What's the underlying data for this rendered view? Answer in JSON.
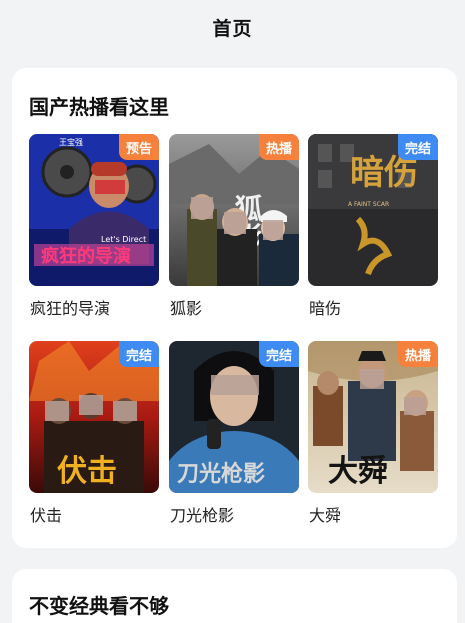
{
  "header": {
    "title": "首页"
  },
  "sections": [
    {
      "title": "国产热播看这里",
      "items": [
        {
          "name": "疯狂的导演",
          "badge": "预告",
          "badge_color": "#f5813c"
        },
        {
          "name": "狐影",
          "badge": "热播",
          "badge_color": "#f5813c"
        },
        {
          "name": "暗伤",
          "badge": "完结",
          "badge_color": "#3d8bf3"
        },
        {
          "name": "伏击",
          "badge": "完结",
          "badge_color": "#3d8bf3"
        },
        {
          "name": "刀光枪影",
          "badge": "完结",
          "badge_color": "#3d8bf3"
        },
        {
          "name": "大舜",
          "badge": "热播",
          "badge_color": "#f5813c"
        }
      ]
    },
    {
      "title": "不变经典看不够"
    }
  ],
  "poster_art": {
    "p0": {
      "title": "疯狂的导演",
      "sub": "Let's Direct",
      "top": "王宝强"
    },
    "p1": {
      "title": "狐影"
    },
    "p2": {
      "title": "暗伤",
      "sub": "A FAINT SCAR"
    },
    "p3": {
      "title": "伏击"
    },
    "p4": {
      "title": "刀光枪影"
    },
    "p5": {
      "title": "大舜"
    }
  }
}
